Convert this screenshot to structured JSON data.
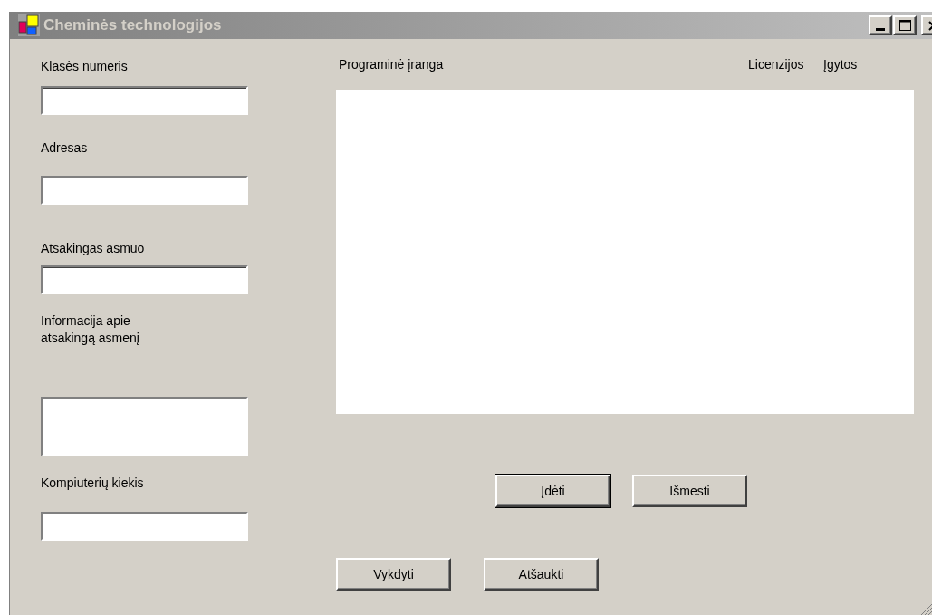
{
  "window": {
    "title": "Cheminės technologijos"
  },
  "fields": [
    {
      "label": "Klasės numeris",
      "kind": "text"
    },
    {
      "label": "Adresas",
      "kind": "text"
    },
    {
      "label": "Atsakingas asmuo",
      "kind": "text"
    },
    {
      "label": "Informacija apie atsakingą asmenį",
      "kind": "multiline"
    },
    {
      "label": "Kompiuterių kiekis",
      "kind": "text"
    }
  ],
  "software_list": {
    "columns": [
      "Programinė įranga",
      "Licenzijos",
      "Įgytos"
    ]
  },
  "list_buttons": [
    {
      "label": "Įdėti",
      "default": true
    },
    {
      "label": "Išmesti",
      "default": false
    }
  ],
  "dialog_buttons": [
    {
      "label": "Vykdyti",
      "default": false
    },
    {
      "label": "Atšaukti",
      "default": false
    }
  ]
}
